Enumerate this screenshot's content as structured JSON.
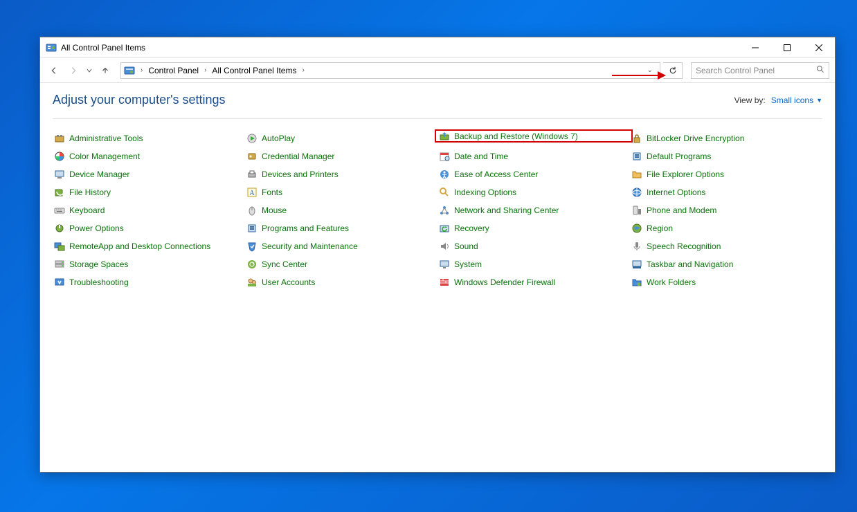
{
  "window": {
    "title": "All Control Panel Items"
  },
  "breadcrumb": {
    "seg1": "Control Panel",
    "seg2": "All Control Panel Items"
  },
  "search": {
    "placeholder": "Search Control Panel"
  },
  "header": {
    "page_title": "Adjust your computer's settings",
    "viewby_label": "View by:",
    "viewby_value": "Small icons"
  },
  "items": {
    "c0": [
      "Administrative Tools",
      "Color Management",
      "Device Manager",
      "File History",
      "Keyboard",
      "Power Options",
      "RemoteApp and Desktop Connections",
      "Storage Spaces",
      "Troubleshooting"
    ],
    "c1": [
      "AutoPlay",
      "Credential Manager",
      "Devices and Printers",
      "Fonts",
      "Mouse",
      "Programs and Features",
      "Security and Maintenance",
      "Sync Center",
      "User Accounts"
    ],
    "c2": [
      "Backup and Restore (Windows 7)",
      "Date and Time",
      "Ease of Access Center",
      "Indexing Options",
      "Network and Sharing Center",
      "Recovery",
      "Sound",
      "System",
      "Windows Defender Firewall"
    ],
    "c3": [
      "BitLocker Drive Encryption",
      "Default Programs",
      "File Explorer Options",
      "Internet Options",
      "Phone and Modem",
      "Region",
      "Speech Recognition",
      "Taskbar and Navigation",
      "Work Folders"
    ]
  },
  "highlighted_item": "Backup and Restore (Windows 7)",
  "icon_colors": {
    "default_bg": "#5a9bd5"
  }
}
